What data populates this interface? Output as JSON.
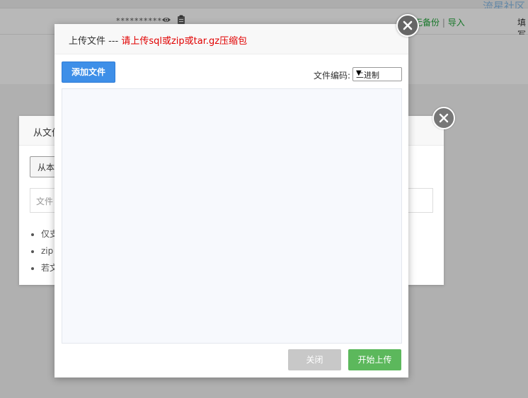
{
  "background": {
    "masked_value": "**********",
    "actions": {
      "backup": "无备份",
      "separator": "|",
      "import": "导入"
    },
    "fill_label": "填写",
    "watermark": "流星社区"
  },
  "back_dialog": {
    "title": "从文件",
    "button_label": "从本",
    "input_placeholder": "文件",
    "list_items": [
      "仅支",
      "zip",
      "若文"
    ]
  },
  "upload_dialog": {
    "title": "上传文件 --- ",
    "hint": "请上传sql或zip或tar.gz压缩包",
    "add_file_label": "添加文件",
    "encoding_label": "文件编码:",
    "encoding_value": "二进制",
    "close_label": "关闭",
    "start_label": "开始上传"
  },
  "colors": {
    "accent_blue": "#3e8fe8",
    "success_green": "#5cb85c",
    "hint_red": "#e10000",
    "disabled_gray": "#c8c8c8"
  },
  "icons": [
    "eye-icon",
    "clipboard-icon",
    "close-icon",
    "dropdown-arrow-icon"
  ]
}
